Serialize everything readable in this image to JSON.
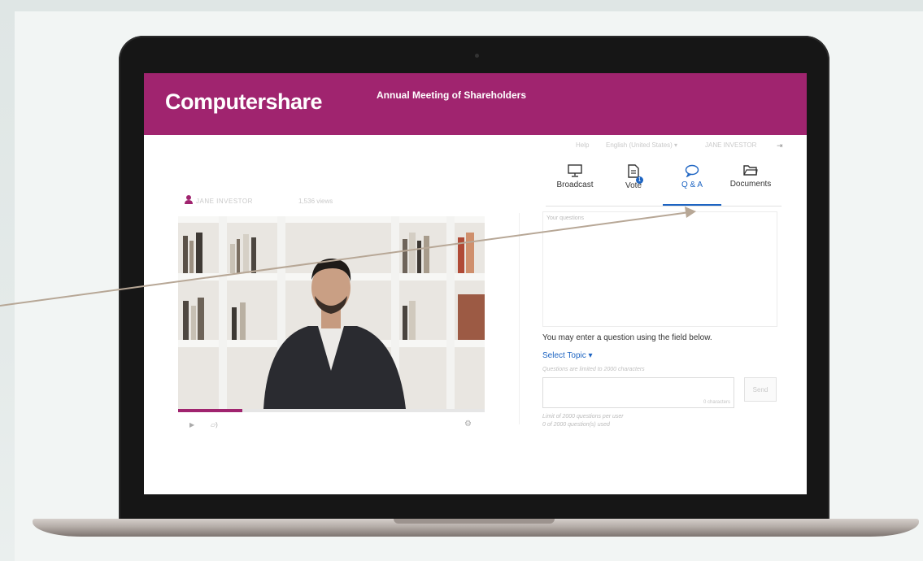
{
  "header": {
    "logo": "Computershare",
    "meeting_title": "Annual Meeting of Shareholders"
  },
  "topbar": {
    "help": "Help",
    "language": "English (United States) ▾",
    "user_name": "JANE INVESTOR"
  },
  "presenter": {
    "name": "JANE INVESTOR",
    "viewers": "1,536 views"
  },
  "tabs": [
    {
      "label": "Broadcast",
      "icon": "monitor-icon"
    },
    {
      "label": "Vote",
      "icon": "document-icon",
      "badge": "1"
    },
    {
      "label": "Q & A",
      "icon": "speech-bubble-icon"
    },
    {
      "label": "Documents",
      "icon": "folder-icon"
    }
  ],
  "qa": {
    "log_label": "Your questions",
    "info": "You may enter a question using the field below.",
    "select_topic": "Select Topic ▾",
    "limit_hint": "Questions are limited to 2000  characters",
    "char_count": "0 characters",
    "send_label": "Send",
    "limit_note": "Limit of 2000 questions per user",
    "used_note": "0 of 2000 question(s) used"
  },
  "video": {
    "progress_percent": 21
  },
  "colors": {
    "brand": "#a0246f",
    "accent": "#1d64c2"
  }
}
